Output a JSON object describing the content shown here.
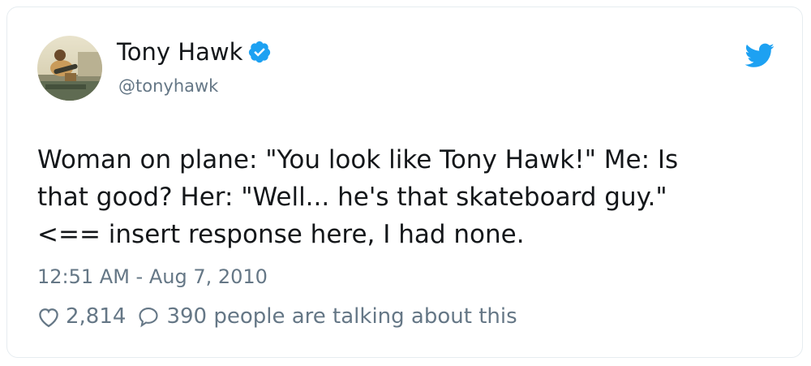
{
  "author": {
    "display_name": "Tony Hawk",
    "handle": "@tonyhawk",
    "verified": true,
    "avatar_icon": "avatar-photo"
  },
  "brand": {
    "icon": "twitter-bird-icon",
    "color": "#1da1f2"
  },
  "tweet": {
    "lines": [
      "Woman on plane: \"You look like Tony Hawk!\" Me: Is",
      "that good? Her: \"Well... he's that skateboard guy.\"",
      "<== insert response here, I had none."
    ],
    "timestamp": "12:51 AM - Aug 7, 2010"
  },
  "actions": {
    "likes": "2,814",
    "talking": "390 people are talking about this"
  },
  "colors": {
    "text": "#14171a",
    "muted": "#657786",
    "border": "#e6ecf0"
  }
}
